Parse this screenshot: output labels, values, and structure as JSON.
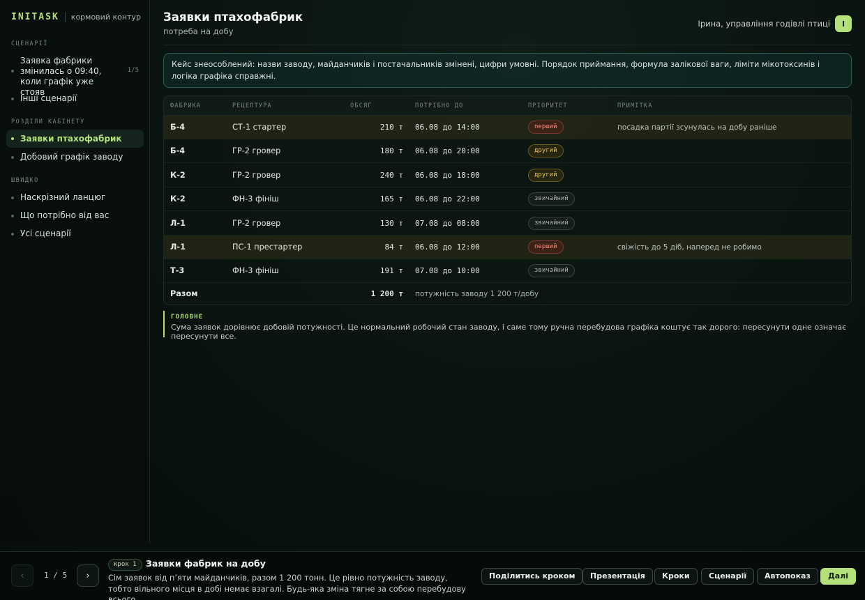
{
  "brand": {
    "logo": "INITASK",
    "subtitle": "кормовий контур"
  },
  "sidebar": {
    "sections": [
      {
        "label": "СЦЕНАРІЇ"
      },
      {
        "label": "РОЗДІЛИ КАБІНЕТУ"
      },
      {
        "label": "ШВИДКО"
      }
    ],
    "scenarios": [
      {
        "label": "Заявка фабрики змінилась о 09:40, коли графік уже стояв",
        "count": "1/5"
      },
      {
        "label": "Інші сценарії"
      }
    ],
    "sections_items": [
      {
        "label": "Заявки птахофабрик",
        "active": true
      },
      {
        "label": "Добовий графік заводу"
      }
    ],
    "quick": [
      {
        "label": "Наскрізний ланцюг"
      },
      {
        "label": "Що потрібно від вас"
      },
      {
        "label": "Усі сценарії"
      }
    ]
  },
  "header": {
    "title": "Заявки птахофабрик",
    "subtitle": "потреба на добу",
    "user": "Ірина, управління годівлі птиці",
    "avatar": "І"
  },
  "notice": "Кейс знеособлений: назви заводу, майданчиків і постачальників змінені, цифри умовні. Порядок приймання, формула залікової ваги, ліміти мікотоксинів і логіка графіка справжні.",
  "table": {
    "columns": [
      "ФАБРИКА",
      "РЕЦЕПТУРА",
      "ОБСЯГ",
      "ПОТРІБНО ДО",
      "ПРІОРИТЕТ",
      "ПРИМІТКА"
    ],
    "rows": [
      {
        "factory": "Б-4",
        "recipe": "СТ-1 стартер",
        "volume": "210 т",
        "due": "06.08 до 14:00",
        "priority": "перший",
        "priority_level": 1,
        "note": "посадка партії зсунулась на добу раніше",
        "highlight": true
      },
      {
        "factory": "Б-4",
        "recipe": "ГР-2 гровер",
        "volume": "180 т",
        "due": "06.08 до 20:00",
        "priority": "другий",
        "priority_level": 2,
        "note": "",
        "highlight": false
      },
      {
        "factory": "К-2",
        "recipe": "ГР-2 гровер",
        "volume": "240 т",
        "due": "06.08 до 18:00",
        "priority": "другий",
        "priority_level": 2,
        "note": "",
        "highlight": false
      },
      {
        "factory": "К-2",
        "recipe": "ФН-3 фініш",
        "volume": "165 т",
        "due": "06.08 до 22:00",
        "priority": "звичайний",
        "priority_level": 3,
        "note": "",
        "highlight": false
      },
      {
        "factory": "Л-1",
        "recipe": "ГР-2 гровер",
        "volume": "130 т",
        "due": "07.08 до 08:00",
        "priority": "звичайний",
        "priority_level": 3,
        "note": "",
        "highlight": false
      },
      {
        "factory": "Л-1",
        "recipe": "ПС-1 престартер",
        "volume": "84 т",
        "due": "06.08 до 12:00",
        "priority": "перший",
        "priority_level": 1,
        "note": "свіжість до 5 діб, наперед не робимо",
        "highlight": true
      },
      {
        "factory": "Т-3",
        "recipe": "ФН-3 фініш",
        "volume": "191 т",
        "due": "07.08 до 10:00",
        "priority": "звичайний",
        "priority_level": 3,
        "note": "",
        "highlight": false
      }
    ],
    "total": {
      "label": "Разом",
      "volume": "1 200 т",
      "note": "потужність заводу 1 200 т/добу"
    }
  },
  "main_point": {
    "label": "ГОЛОВНЕ",
    "text": "Сума заявок дорівнює добовій потужності. Це нормальний робочий стан заводу, і саме тому ручна перебудова графіка коштує так дорого: пересунути одне означає пересунути все."
  },
  "footer": {
    "prev": "‹",
    "next": "›",
    "pager": "1 / 5",
    "step_badge": "крок 1",
    "step_title": "Заявки фабрик на добу",
    "step_desc": "Сім заявок від п’яти майданчиків, разом 1 200 тонн. Це рівно потужність заводу, тобто вільного місця в добі немає взагалі. Будь-яка зміна тягне за собою перебудову всього.",
    "buttons": [
      "Поділитись кроком",
      "Презентація",
      "Кроки",
      "Сценарії",
      "Автопоказ",
      "Далі"
    ]
  },
  "colors": {
    "accent": "#b4e07a",
    "priority_first": "#ff8a7a",
    "priority_second": "#e7c25a",
    "priority_normal": "#a7b3ad"
  }
}
